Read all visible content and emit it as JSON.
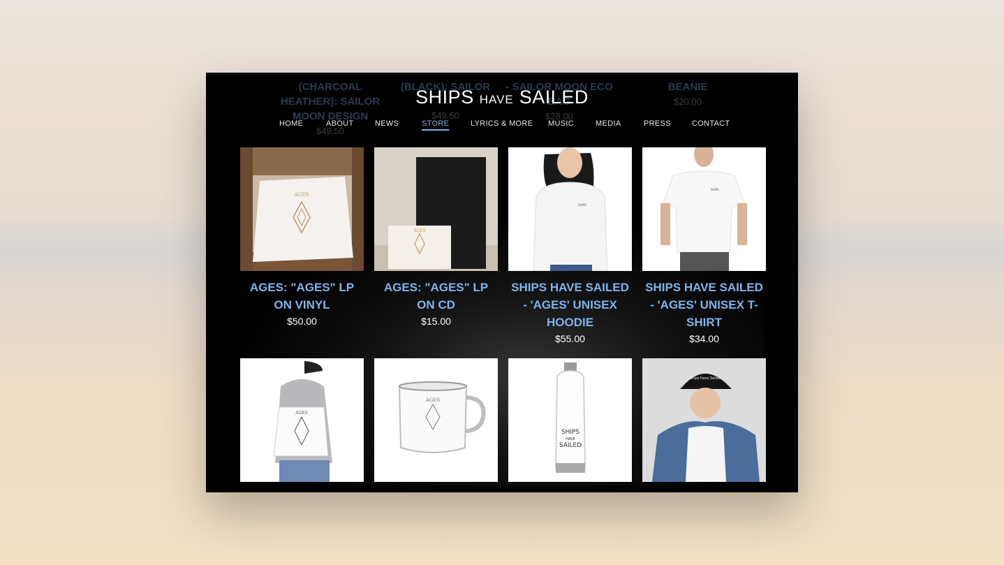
{
  "site": {
    "logo": {
      "part1": "SHIPS",
      "part2": "HAVE",
      "part3": "SAILED"
    },
    "nav": [
      {
        "label": "HOME",
        "active": false
      },
      {
        "label": "ABOUT",
        "active": false
      },
      {
        "label": "NEWS",
        "active": false
      },
      {
        "label": "STORE",
        "active": true
      },
      {
        "label": "LYRICS & MORE",
        "active": false
      },
      {
        "label": "MUSIC",
        "active": false
      },
      {
        "label": "MEDIA",
        "active": false
      },
      {
        "label": "PRESS",
        "active": false
      },
      {
        "label": "CONTACT",
        "active": false
      }
    ]
  },
  "ghost_products": [
    {
      "title": "(CHARCOAL HEATHER): SAILOR MOON DESIGN",
      "price": "$49.50"
    },
    {
      "title": "(BLACK): SAILOR",
      "price": "$49.50"
    },
    {
      "title": "- SAILOR MOON ECO BAG",
      "price": "$28.00"
    },
    {
      "title": "BEANIE",
      "price": "$20.00"
    }
  ],
  "products": [
    {
      "title": "AGES: \"AGES\" LP ON VINYL",
      "price": "$50.00",
      "image": "vinyl-lp-icon"
    },
    {
      "title": "AGES: \"AGES\" LP ON CD",
      "price": "$15.00",
      "image": "cd-icon"
    },
    {
      "title": "SHIPS HAVE SAILED - 'AGES' UNISEX HOODIE",
      "price": "$55.00",
      "image": "hoodie-icon"
    },
    {
      "title": "SHIPS HAVE SAILED - 'AGES' UNISEX T-SHIRT",
      "price": "$34.00",
      "image": "tshirt-icon"
    },
    {
      "title": "",
      "price": "",
      "image": "drawstring-bag-icon"
    },
    {
      "title": "",
      "price": "",
      "image": "enamel-mug-icon"
    },
    {
      "title": "",
      "price": "",
      "image": "water-bottle-icon"
    },
    {
      "title": "",
      "price": "",
      "image": "dad-hat-icon"
    }
  ],
  "product_images": {
    "bottle_text": [
      "SHIPS",
      "HAVE",
      "SAILED"
    ],
    "cap_text": "Ships have Sailed",
    "print_text": "AGES"
  },
  "colors": {
    "accent": "#7fb3ec",
    "page_background": "#000000",
    "price_text": "#ffffff"
  }
}
